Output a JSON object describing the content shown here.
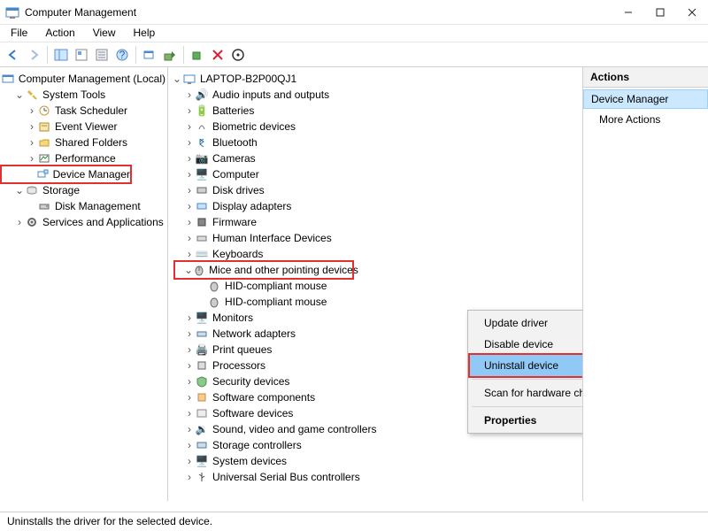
{
  "window": {
    "title": "Computer Management"
  },
  "menubar": [
    "File",
    "Action",
    "View",
    "Help"
  ],
  "left_tree": {
    "root": "Computer Management (Local)",
    "system_tools": "System Tools",
    "task_scheduler": "Task Scheduler",
    "event_viewer": "Event Viewer",
    "shared_folders": "Shared Folders",
    "performance": "Performance",
    "device_manager": "Device Manager",
    "storage": "Storage",
    "disk_management": "Disk Management",
    "services": "Services and Applications"
  },
  "device_root": "LAPTOP-B2P00QJ1",
  "categories": {
    "audio": "Audio inputs and outputs",
    "batteries": "Batteries",
    "biometric": "Biometric devices",
    "bluetooth": "Bluetooth",
    "cameras": "Cameras",
    "computer": "Computer",
    "disk": "Disk drives",
    "display": "Display adapters",
    "firmware": "Firmware",
    "hid": "Human Interface Devices",
    "keyboards": "Keyboards",
    "mice": "Mice and other pointing devices",
    "mouse1": "HID-compliant mouse",
    "mouse2": "HID-compliant mouse",
    "monitors": "Monitors",
    "network": "Network adapters",
    "printq": "Print queues",
    "processors": "Processors",
    "security": "Security devices",
    "softcomp": "Software components",
    "softdev": "Software devices",
    "sound": "Sound, video and game controllers",
    "storage_ctrl": "Storage controllers",
    "sysdev": "System devices",
    "usb": "Universal Serial Bus controllers"
  },
  "context_menu": {
    "update": "Update driver",
    "disable": "Disable device",
    "uninstall": "Uninstall device",
    "scan": "Scan for hardware changes",
    "properties": "Properties"
  },
  "actions_pane": {
    "header": "Actions",
    "selected": "Device Manager",
    "more": "More Actions"
  },
  "statusbar": "Uninstalls the driver for the selected device.",
  "glyphs": {
    "expanded": "⌄",
    "collapsed": "›"
  }
}
